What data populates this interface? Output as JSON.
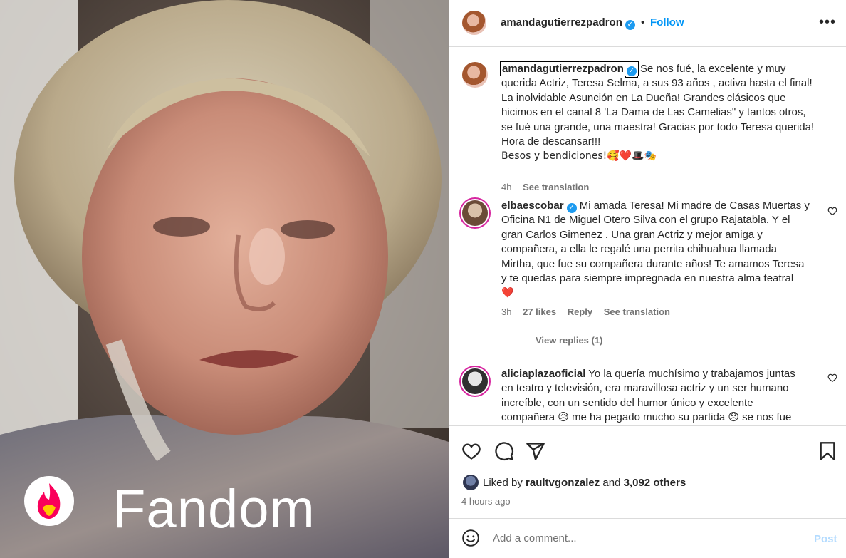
{
  "media": {
    "watermark_text": "Fandom",
    "logo_icon": "fandom-flame-logo"
  },
  "header": {
    "username": "amandagutierrezpadron",
    "verified_icon": "verified-badge-icon",
    "separator": "•",
    "follow_label": "Follow",
    "more_label": "•••"
  },
  "caption": {
    "username": "amandagutierrezpadron",
    "lines": [
      "Se nos fué, la excelente y muy",
      "querida Actriz, Teresa Selma, a sus 93 años , activa hasta el final!",
      "La inolvidable Asunción en La Dueña! Grandes clásicos que",
      "hicimos en el canal 8 'La Dama de Las Camelias\" y tantos otros,",
      "se fué una grande, una maestra! Gracias por todo Teresa querida!",
      "Hora de descansar!!!",
      "Besos y bendiciones!🥰❤️🎩🎭"
    ],
    "time": "4h",
    "see_translation": "See translation"
  },
  "comments": [
    {
      "username": "elbaescobar",
      "lines": [
        "Mi amada Teresa! Mi madre de Casas Muertas y",
        "Oficina N1 de Miguel Otero Silva con el grupo Rajatabla. Y el",
        "gran Carlos Gimenez . Una gran Actriz y mejor amiga y",
        "compañera, a ella le regalé una perrita chihuahua llamada",
        "Mirtha, que fue su compañera durante años! Te amamos Teresa",
        "y te quedas para siempre impregnada en nuestra alma teatral",
        "❤️"
      ],
      "time": "3h",
      "likes": "27 likes",
      "reply": "Reply",
      "see_translation": "See translation",
      "view_replies": "View replies (1)"
    },
    {
      "username": "aliciaplazaoficial",
      "lines": [
        "Yo la quería muchísimo y trabajamos juntas",
        "en teatro y televisión, era maravillosa actriz y un ser humano",
        "increíble, con un sentido del humor único y excelente",
        "compañera 😥 me ha pegado mucho su partida 😞 se nos fue"
      ]
    }
  ],
  "actions": {
    "like_icon": "heart-icon",
    "comment_icon": "comment-icon",
    "share_icon": "send-icon",
    "save_icon": "bookmark-icon"
  },
  "likes": {
    "prefix": "Liked by",
    "user": "raultvgonzalez",
    "and": "and",
    "others": "3,092 others"
  },
  "post_time": "4 hours ago",
  "add_comment": {
    "placeholder": "Add a comment...",
    "post_label": "Post",
    "emoji_icon": "emoji-icon"
  }
}
